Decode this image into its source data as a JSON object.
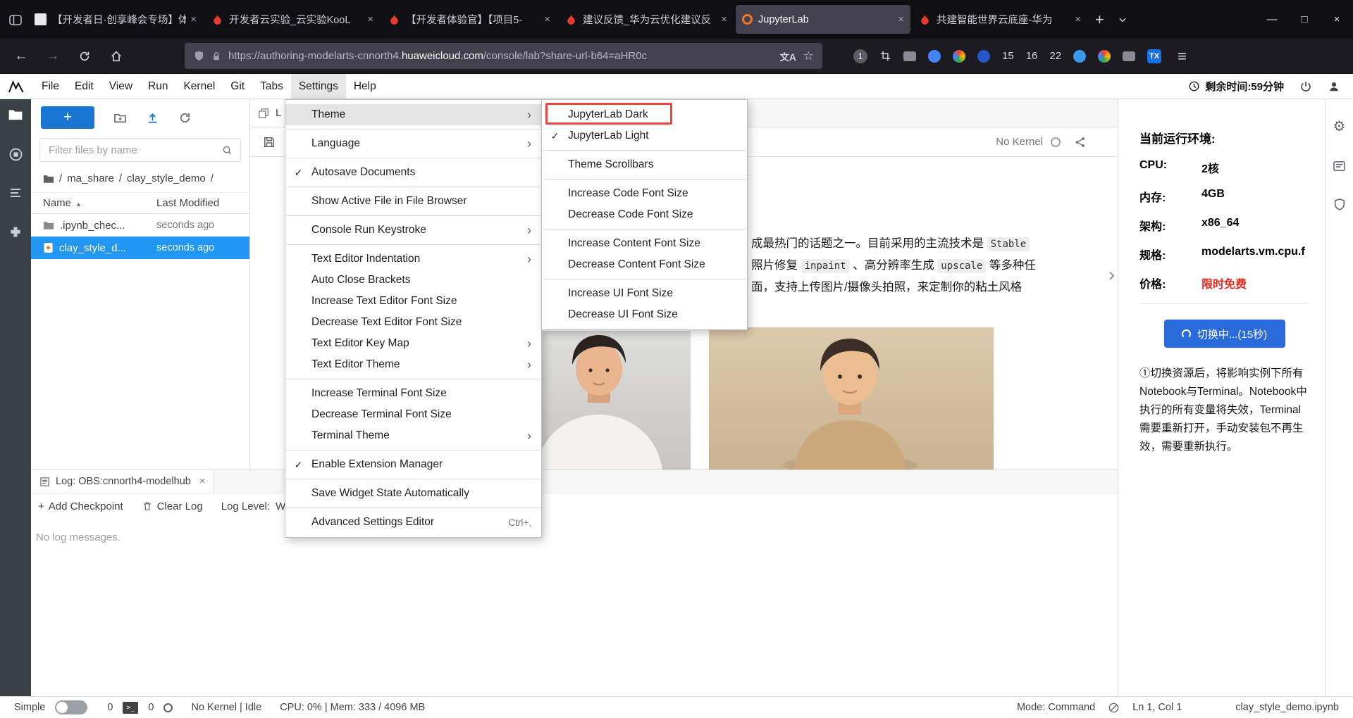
{
  "colors": {
    "selection_blue": "#2196f3",
    "toolbar_blue": "#1976d2",
    "switch_button_blue": "#2a6bdb",
    "price_red": "#e22b20",
    "annotation_red": "#e5483d",
    "jupyter_orange": "#f37626",
    "flame_red": "#e6392f"
  },
  "browser": {
    "tabs": [
      {
        "title": "【开发者日·创享峰会专场】体"
      },
      {
        "title": "开发者云实验_云实验KooL"
      },
      {
        "title": "【开发者体验官】【项目5-"
      },
      {
        "title": "建议反馈_华为云优化建议反"
      },
      {
        "title": "JupyterLab"
      },
      {
        "title": "共建智能世界云底座-华为"
      }
    ],
    "close_glyph": "×",
    "new_tab_label": "+",
    "window_controls": {
      "minimize": "—",
      "maximize": "□",
      "close": "×"
    },
    "nav": {
      "back": "←",
      "forward": "→",
      "url_prefix": "https://authoring-modelarts-cnnorth4.",
      "url_domain": "huaweicloud.com",
      "url_path": "/console/lab?share-url-b64=aHR0c",
      "translate_label": "文A",
      "star_glyph": "☆",
      "menu_glyph": "≡"
    },
    "extensions": {
      "badge": "1",
      "count1": "15",
      "count2": "16",
      "count3": "22",
      "tx": "TX"
    }
  },
  "menubar": {
    "items": [
      "File",
      "Edit",
      "View",
      "Run",
      "Kernel",
      "Git",
      "Tabs",
      "Settings",
      "Help"
    ],
    "time_remaining": "剩余时间:59分钟"
  },
  "settings_menu": {
    "items": [
      {
        "label": "Theme",
        "arrow": true,
        "highlighted": true
      },
      {
        "label": "Language",
        "arrow": true
      },
      {
        "label": "Autosave Documents",
        "check": true
      },
      {
        "label": "Show Active File in File Browser"
      },
      {
        "label": "Console Run Keystroke",
        "arrow": true
      },
      {
        "label": "Text Editor Indentation",
        "arrow": true
      },
      {
        "label": "Auto Close Brackets"
      },
      {
        "label": "Increase Text Editor Font Size"
      },
      {
        "label": "Decrease Text Editor Font Size"
      },
      {
        "label": "Text Editor Key Map",
        "arrow": true
      },
      {
        "label": "Text Editor Theme",
        "arrow": true
      },
      {
        "label": "Increase Terminal Font Size"
      },
      {
        "label": "Decrease Terminal Font Size"
      },
      {
        "label": "Terminal Theme",
        "arrow": true
      },
      {
        "label": "Enable Extension Manager",
        "check": true
      },
      {
        "label": "Save Widget State Automatically"
      },
      {
        "label": "Advanced Settings Editor",
        "shortcut": "Ctrl+,"
      }
    ]
  },
  "theme_menu": {
    "items": [
      {
        "label": "JupyterLab Dark",
        "annotated": true
      },
      {
        "label": "JupyterLab Light",
        "check": true
      },
      {
        "label": "Theme Scrollbars"
      },
      {
        "label": "Increase Code Font Size"
      },
      {
        "label": "Decrease Code Font Size"
      },
      {
        "label": "Increase Content Font Size"
      },
      {
        "label": "Decrease Content Font Size"
      },
      {
        "label": "Increase UI Font Size"
      },
      {
        "label": "Decrease UI Font Size"
      }
    ]
  },
  "file_browser": {
    "filter_placeholder": "Filter files by name",
    "breadcrumb": [
      "/",
      "ma_share",
      "/",
      "clay_style_demo",
      "/"
    ],
    "columns": {
      "name": "Name",
      "modified": "Last Modified"
    },
    "sort_arrow": "▲",
    "rows": [
      {
        "name": ".ipynb_chec...",
        "modified": "seconds ago"
      },
      {
        "name": "clay_style_d...",
        "modified": "seconds ago"
      }
    ]
  },
  "editor": {
    "tab_text": "L",
    "kernel_label": "No Kernel",
    "markdown": {
      "line1_pre": "成最热门的话题之一。目前采用的主流技术是 ",
      "line1_code": "Stable",
      "line2_pre": "照片修复 ",
      "line2_code1": "inpaint",
      "line2_mid": " 、高分辨率生成 ",
      "line2_code2": "upscale",
      "line2_post": " 等多种任",
      "line3": "面，支持上传图片/摄像头拍照，来定制你的粘土风格"
    }
  },
  "log_panel": {
    "tab_title": "Log: OBS:cnnorth4-modelhub",
    "close_glyph": "×",
    "add_checkpoint": "Add Checkpoint",
    "clear_log": "Clear Log",
    "log_level_label": "Log Level:",
    "log_level_value": "W",
    "empty_message": "No log messages."
  },
  "env_panel": {
    "title": "当前运行环境:",
    "specs": [
      {
        "label": "CPU:",
        "value": "2核"
      },
      {
        "label": "内存:",
        "value": "4GB"
      },
      {
        "label": "架构:",
        "value": "x86_64"
      },
      {
        "label": "规格:",
        "value": "modelarts.vm.cpu.f"
      },
      {
        "label": "价格:",
        "value": "限时免费"
      }
    ],
    "switch_button_label": "切换中...(15秒)",
    "note": "①切换资源后，将影响实例下所有Notebook与Terminal。Notebook中执行的所有变量将失效，Terminal需要重新打开，手动安装包不再生效，需要重新执行。"
  },
  "status_bar": {
    "simple_label": "Simple",
    "terminal_count": "0",
    "kernel_count": "0",
    "kernel_status": "No Kernel | Idle",
    "resources": "CPU: 0% | Mem: 333 / 4096 MB",
    "mode": "Mode: Command",
    "cursor_position": "Ln 1, Col 1",
    "active_file": "clay_style_demo.ipynb"
  }
}
